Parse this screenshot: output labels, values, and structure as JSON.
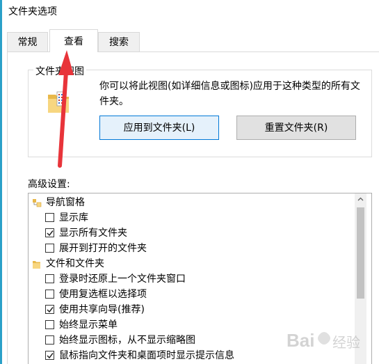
{
  "window": {
    "title": "文件夹选项"
  },
  "tabs": [
    {
      "label": "常规",
      "active": false
    },
    {
      "label": "查看",
      "active": true
    },
    {
      "label": "搜索",
      "active": false
    }
  ],
  "folder_views": {
    "legend": "文件夹视图",
    "description": "你可以将此视图(如详细信息或图标)应用于这种类型的所有文件夹。",
    "apply_button": "应用到文件夹(L)",
    "reset_button": "重置文件夹(R)"
  },
  "advanced": {
    "label": "高级设置:",
    "items": [
      {
        "type": "category",
        "label": "导航窗格",
        "icon": "navigation-pane-icon"
      },
      {
        "type": "checkbox",
        "label": "显示库",
        "checked": false
      },
      {
        "type": "checkbox",
        "label": "显示所有文件夹",
        "checked": true
      },
      {
        "type": "checkbox",
        "label": "展开到打开的文件夹",
        "checked": false
      },
      {
        "type": "category",
        "label": "文件和文件夹",
        "icon": "folder-icon"
      },
      {
        "type": "checkbox",
        "label": "登录时还原上一个文件夹窗口",
        "checked": false
      },
      {
        "type": "checkbox",
        "label": "使用复选框以选择项",
        "checked": false
      },
      {
        "type": "checkbox",
        "label": "使用共享向导(推荐)",
        "checked": true
      },
      {
        "type": "checkbox",
        "label": "始终显示菜单",
        "checked": false
      },
      {
        "type": "checkbox",
        "label": "始终显示图标，从不显示缩略图",
        "checked": false
      },
      {
        "type": "checkbox",
        "label": "鼠标指向文件夹和桌面项时显示提示信息",
        "checked": true
      }
    ]
  },
  "watermark": {
    "text": "Bai经验"
  },
  "colors": {
    "accent": "#0078d7",
    "annotation_arrow": "#e8343a",
    "window_accent": "#2aa0c8"
  }
}
